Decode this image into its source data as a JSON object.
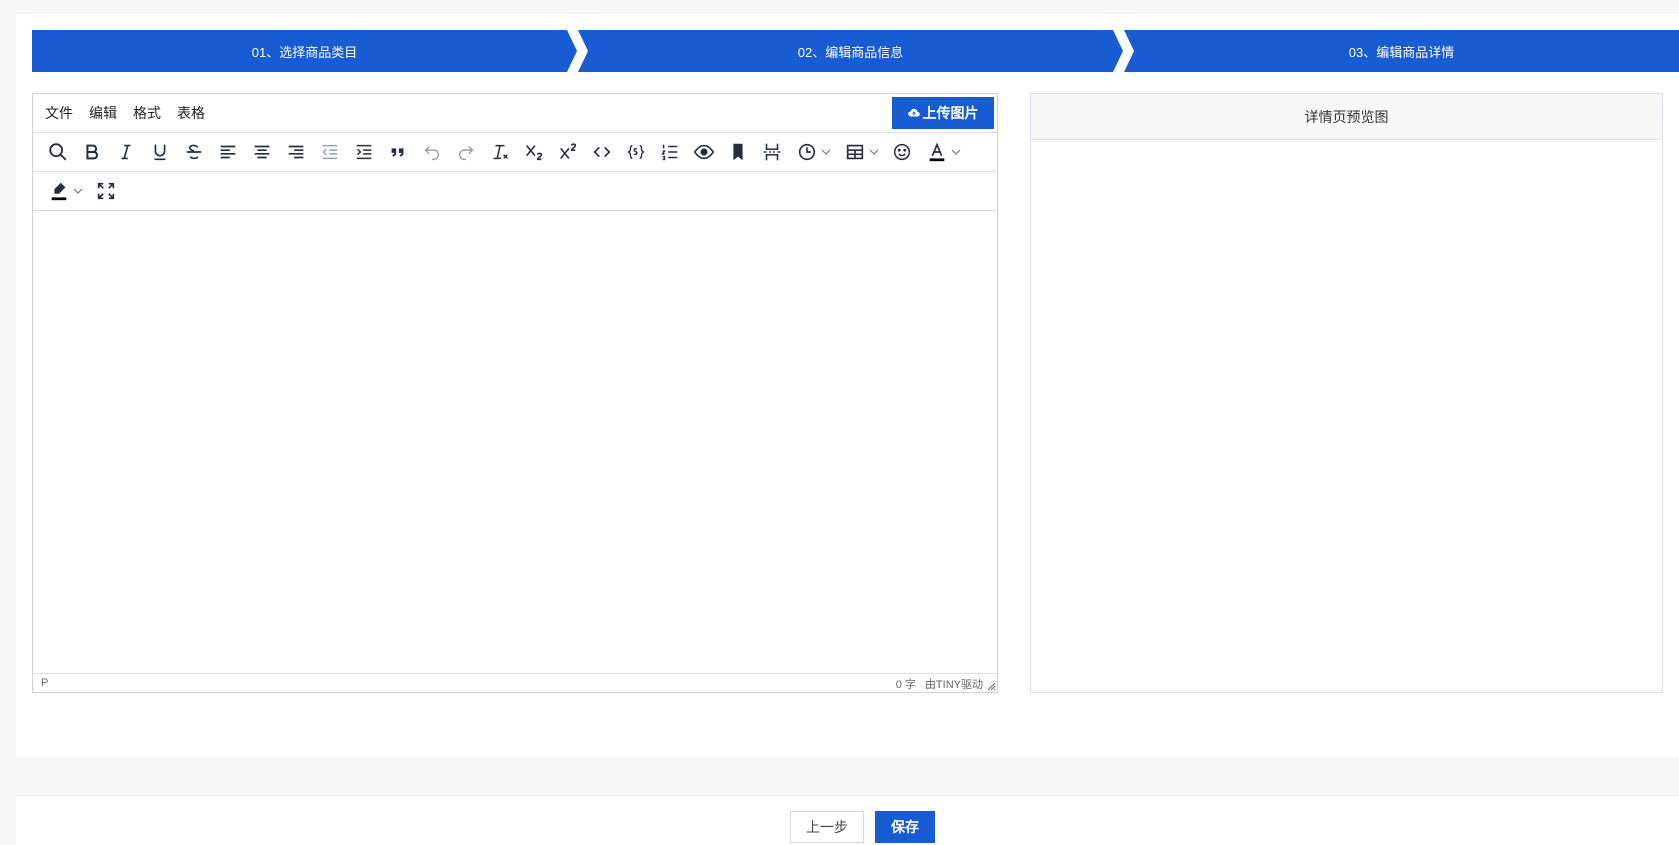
{
  "steps": [
    {
      "label": "01、选择商品类目"
    },
    {
      "label": "02、编辑商品信息"
    },
    {
      "label": "03、编辑商品详情"
    }
  ],
  "editor": {
    "menu": [
      "文件",
      "编辑",
      "格式",
      "表格"
    ],
    "upload_label": "上传图片",
    "toolbar_icons": [
      "search-icon",
      "bold-icon",
      "italic-icon",
      "underline-icon",
      "strikethrough-icon",
      "align-left-icon",
      "align-center-icon",
      "align-right-icon",
      "outdent-icon",
      "indent-icon",
      "blockquote-icon",
      "undo-icon",
      "redo-icon",
      "remove-format-icon",
      "subscript-icon",
      "superscript-icon",
      "code-icon",
      "codesample-icon",
      "numbered-list-icon",
      "preview-icon",
      "bookmark-icon",
      "page-break-icon",
      "time-icon",
      "table-icon",
      "emoji-icon",
      "text-color-icon",
      "highlight-color-icon",
      "fullscreen-icon"
    ],
    "status_path": "P",
    "word_count": "0 字",
    "powered_by": "由TINY驱动"
  },
  "preview": {
    "title": "详情页预览图"
  },
  "footer": {
    "prev_label": "上一步",
    "save_label": "保存"
  },
  "colors": {
    "primary": "#175cd3",
    "background": "#f7f7f8",
    "icon": "#222f3e"
  }
}
